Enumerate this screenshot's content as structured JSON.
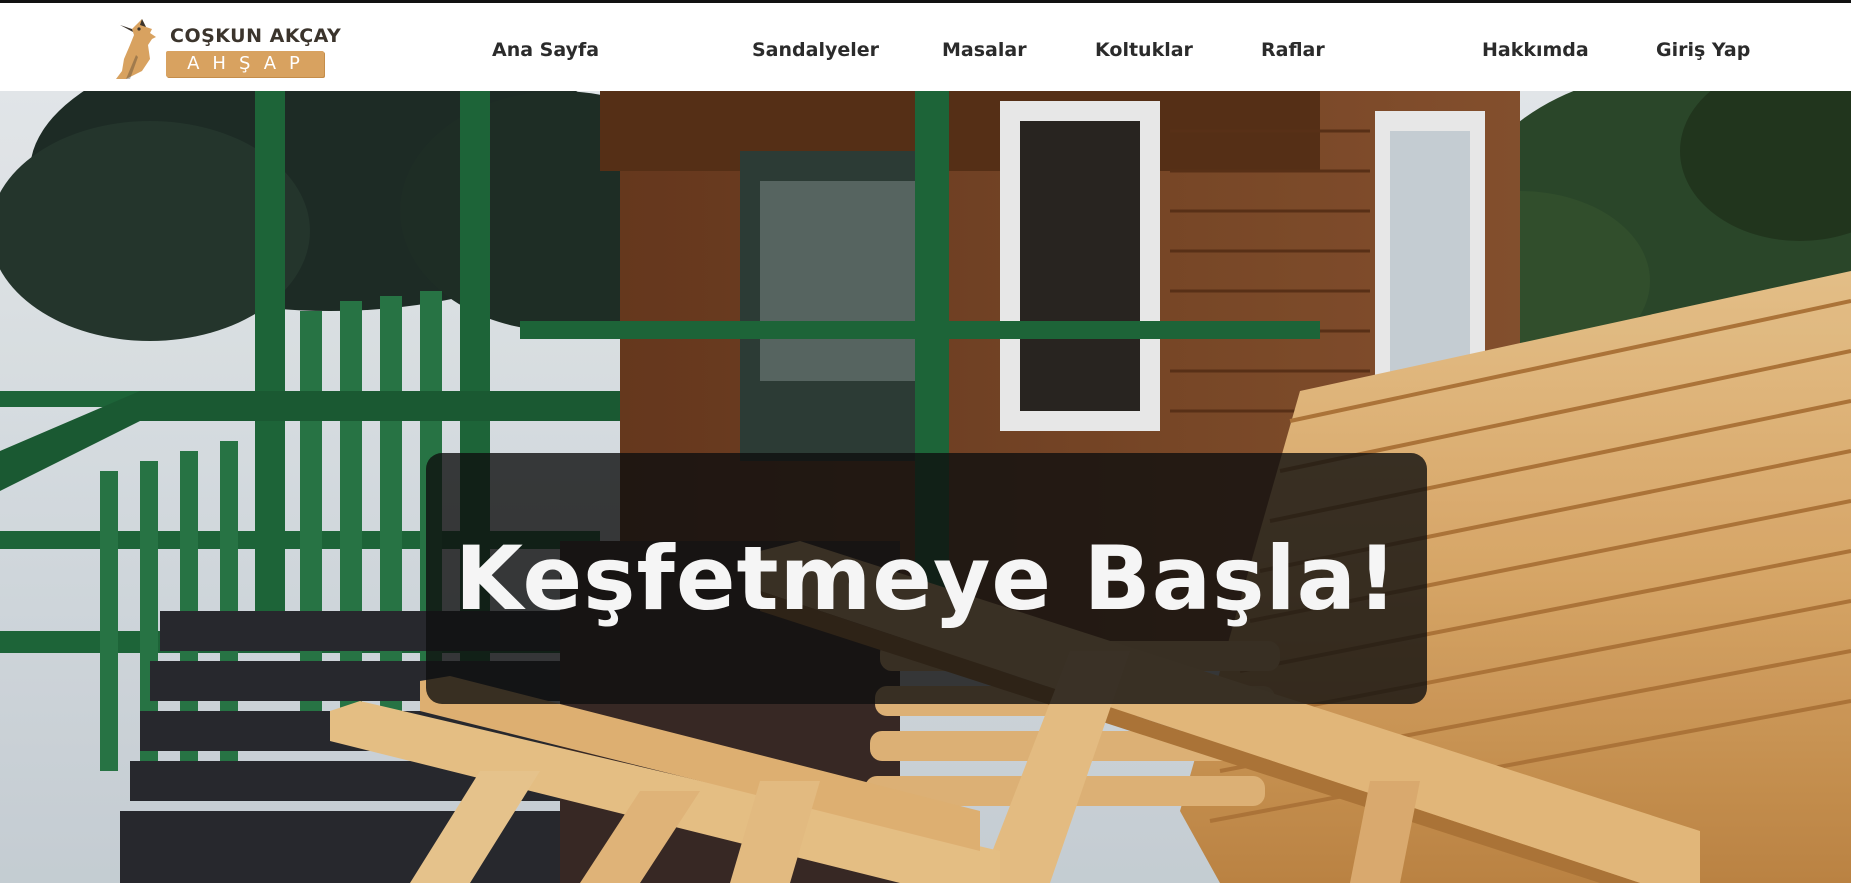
{
  "header": {
    "logo": {
      "top_text": "COŞKUN AKÇAY",
      "bottom_text": "AHŞAP",
      "colors": {
        "text": "#3b342c",
        "accent": "#d8a260"
      }
    },
    "nav": [
      {
        "label": "Ana Sayfa"
      },
      {
        "label": "Sandalyeler"
      },
      {
        "label": "Masalar"
      },
      {
        "label": "Koltuklar"
      },
      {
        "label": "Raflar"
      },
      {
        "label": "Hakkımda"
      },
      {
        "label": "Giriş Yap"
      }
    ]
  },
  "hero": {
    "title": "Keşfetmeye Başla!",
    "background": "photo-wooden-house-and-lounge-chairs"
  }
}
